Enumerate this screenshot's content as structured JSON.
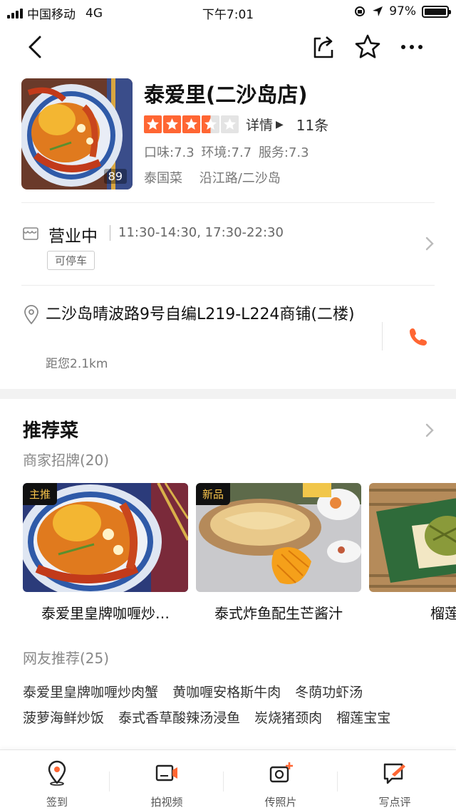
{
  "status_bar": {
    "carrier": "中国移动",
    "network": "4G",
    "time": "下午7:01",
    "battery": "97%"
  },
  "shop": {
    "name": "泰爱里(二沙岛店)",
    "photo_count": "89",
    "rating_stars": 3.5,
    "detail_label": "详情",
    "review_count": "11条",
    "scores": {
      "taste": "口味:7.3",
      "environment": "环境:7.7",
      "service": "服务:7.3"
    },
    "cuisine": "泰国菜",
    "area": "沿江路/二沙岛"
  },
  "hours": {
    "status": "营业中",
    "time": "11:30-14:30, 17:30-22:30",
    "parking": "可停车"
  },
  "address": {
    "line": "二沙岛晴波路9号自编L219-L224商铺(二楼)",
    "distance": "距您2.1km"
  },
  "recommend": {
    "title": "推荐菜",
    "merchant_label": "商家招牌(20)",
    "dishes": [
      {
        "badge": "主推",
        "name": "泰爱里皇牌咖喱炒…"
      },
      {
        "badge": "新品",
        "name": "泰式炸鱼配生芒酱汁"
      },
      {
        "badge": "",
        "name": "榴莲宝"
      }
    ],
    "netizen_label": "网友推荐(25)",
    "netizen_items": [
      "泰爱里皇牌咖喱炒肉蟹",
      "黄咖喱安格斯牛肉",
      "冬荫功虾汤",
      "菠萝海鲜炒饭",
      "泰式香草酸辣汤浸鱼",
      "炭烧猪颈肉",
      "榴莲宝宝"
    ]
  },
  "bottom_bar": {
    "checkin": "签到",
    "video": "拍视频",
    "photo": "传照片",
    "review": "写点评"
  },
  "colors": {
    "accent": "#ff6633",
    "star_on": "#ff6633",
    "star_off": "#e4e4e4"
  }
}
